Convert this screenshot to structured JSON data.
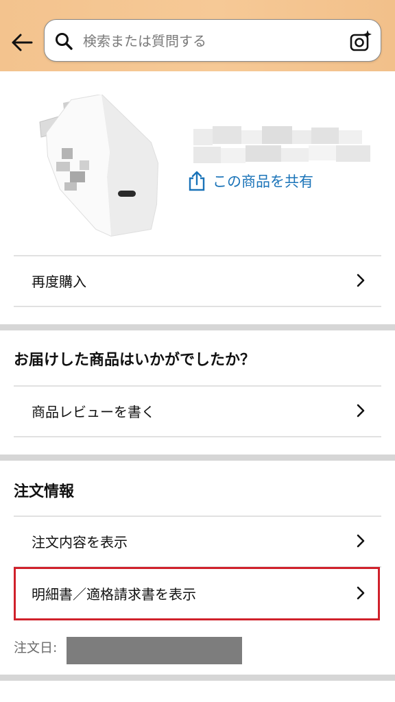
{
  "header": {
    "search_placeholder": "検索または質問する"
  },
  "product": {
    "share_label": "この商品を共有"
  },
  "rows": {
    "buy_again": "再度購入",
    "write_review": "商品レビューを書く",
    "view_order": "注文内容を表示",
    "view_invoice": "明細書／適格請求書を表示"
  },
  "sections": {
    "review_question": "お届けした商品はいかがでしたか？",
    "order_info": "注文情報"
  },
  "order": {
    "date_label": "注文日:"
  },
  "colors": {
    "header_bg": "#f5c795",
    "link_blue": "#1a73b8",
    "highlight_red": "#d0212b"
  }
}
